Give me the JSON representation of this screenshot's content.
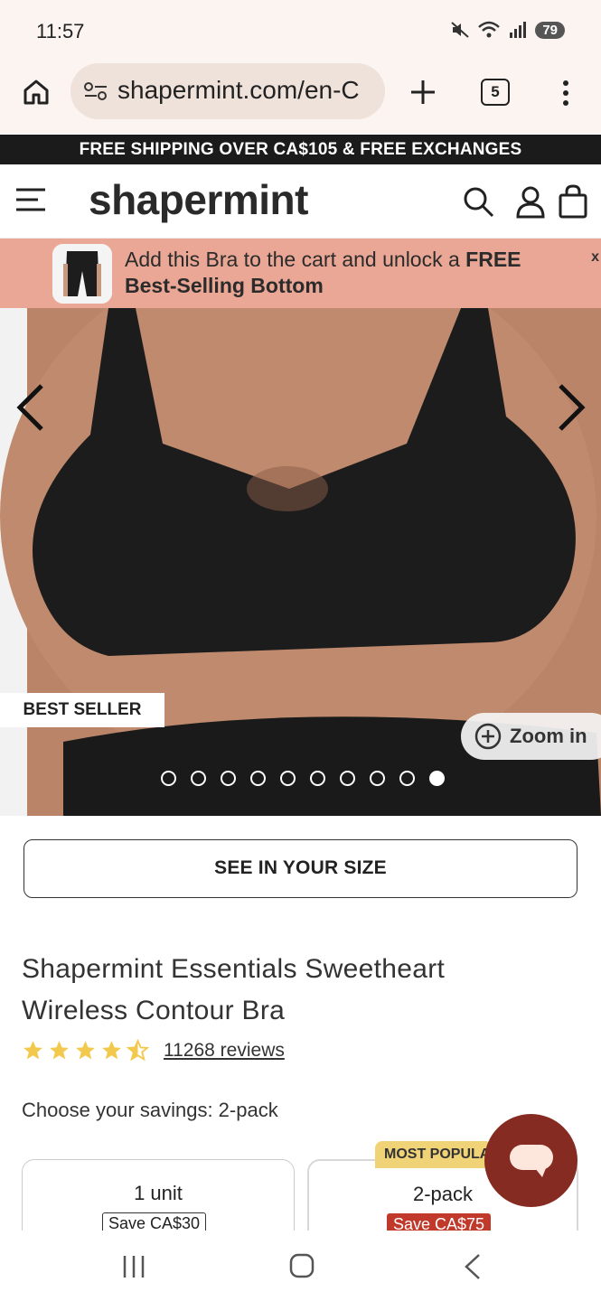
{
  "status_bar": {
    "time": "11:57",
    "battery": "79",
    "icons": [
      "mute-icon",
      "wifi-icon",
      "signal-icon",
      "battery-icon"
    ]
  },
  "browser": {
    "url": "shapermint.com/en-C",
    "tab_count": "5"
  },
  "promo": {
    "text": "FREE SHIPPING OVER CA$105 & FREE EXCHANGES"
  },
  "site_header": {
    "logo": "shapermint"
  },
  "upsell": {
    "text_prefix": "Add this Bra to the cart and unlock a ",
    "text_bold": "FREE",
    "text_bold_line2": "Best-Selling Bottom",
    "close": "x"
  },
  "product_image": {
    "badge": "BEST SELLER",
    "zoom_label": "Zoom in",
    "dot_count": 10,
    "active_dot": 10
  },
  "size_button": {
    "label": "SEE IN YOUR SIZE"
  },
  "product": {
    "title": "Shapermint Essentials Sweetheart Wireless Contour Bra",
    "rating": 4.5,
    "reviews": "11268 reviews",
    "savings_label": "Choose your savings: 2-pack"
  },
  "options": [
    {
      "name": "1 unit",
      "save": "Save CA$30"
    },
    {
      "name": "2-pack",
      "save": "Save CA$75",
      "tag": "MOST POPULAR"
    }
  ],
  "colors": {
    "promo_bg": "#1b1b1b",
    "upsell_bg": "#eaa795",
    "chat_bg": "#862b21",
    "star": "#f2c94c",
    "popular_tag": "#f1d377",
    "save_red": "#c0392b"
  }
}
